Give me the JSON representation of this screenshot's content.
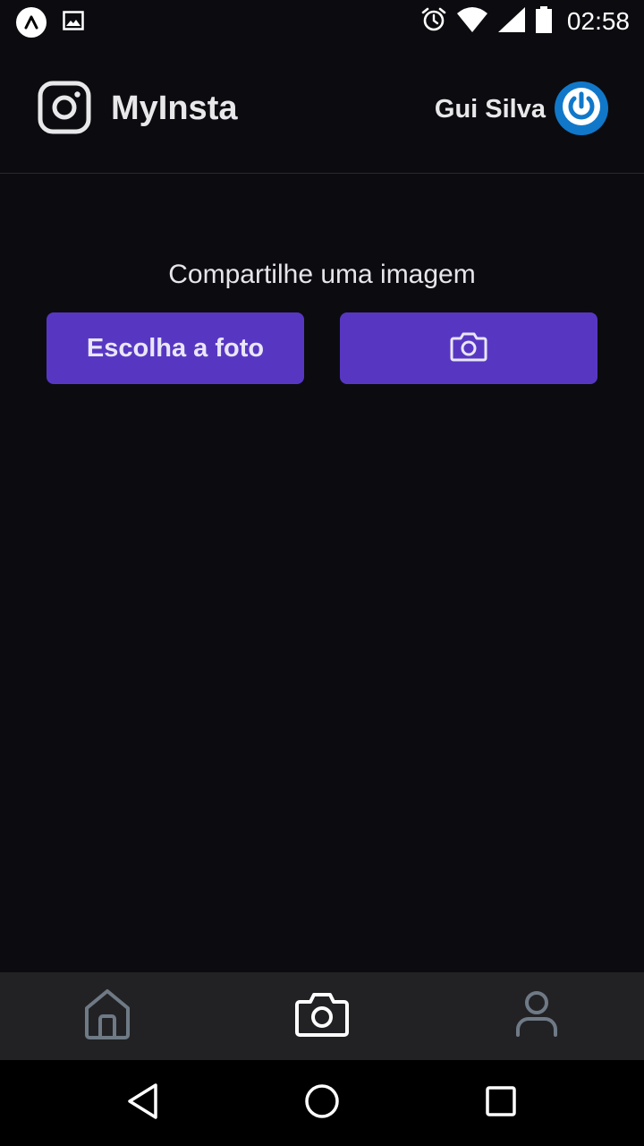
{
  "status_bar": {
    "time": "02:58",
    "left_icons": [
      "expo-icon",
      "image-notification-icon"
    ],
    "right_icons": [
      "alarm-icon",
      "wifi-icon",
      "signal-icon",
      "battery-icon"
    ]
  },
  "header": {
    "app_title": "MyInsta",
    "logo_icon": "instagram-icon",
    "user_name": "Gui Silva",
    "logout_icon": "power-icon"
  },
  "main": {
    "share_text": "Compartilhe uma imagem",
    "choose_photo_label": "Escolha a foto",
    "camera_button_icon": "camera-icon"
  },
  "tab_bar": {
    "tabs": [
      {
        "icon": "home-icon",
        "active": false
      },
      {
        "icon": "camera-icon",
        "active": true
      },
      {
        "icon": "user-icon",
        "active": false
      }
    ]
  },
  "nav_bar": {
    "buttons": [
      "back-icon",
      "home-circle-icon",
      "recents-icon"
    ]
  },
  "colors": {
    "background": "#0c0c10",
    "button": "#5737c2",
    "logout_button": "#1178c9",
    "tab_bar": "#222224",
    "tab_active": "#ffffff",
    "tab_inactive": "#6f7a86"
  }
}
